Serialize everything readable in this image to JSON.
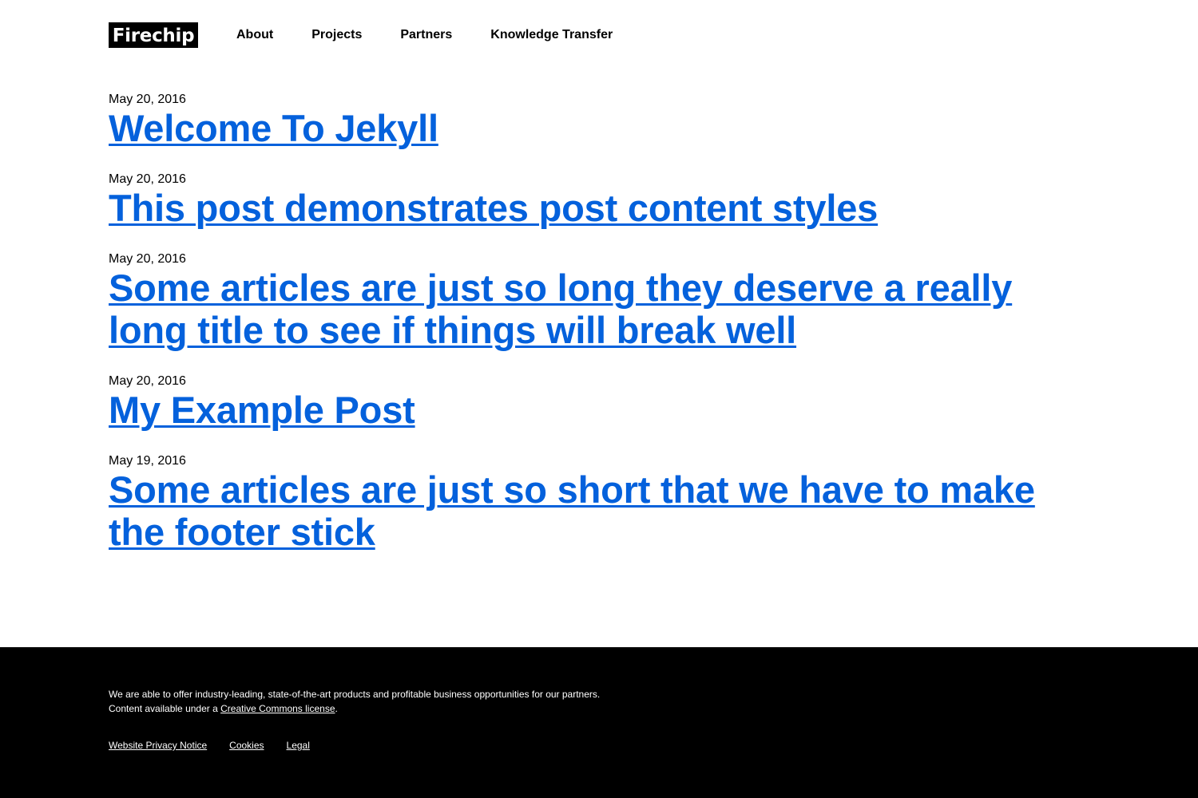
{
  "header": {
    "logo_text": "Firechip",
    "nav": [
      {
        "label": "About"
      },
      {
        "label": "Projects"
      },
      {
        "label": "Partners"
      },
      {
        "label": "Knowledge Transfer"
      }
    ]
  },
  "posts": [
    {
      "date": "May 20, 2016",
      "title": "Welcome To Jekyll"
    },
    {
      "date": "May 20, 2016",
      "title": "This post demonstrates post content styles"
    },
    {
      "date": "May 20, 2016",
      "title": "Some articles are just so long they deserve a really long title to see if things will break well"
    },
    {
      "date": "May 20, 2016",
      "title": "My Example Post"
    },
    {
      "date": "May 19, 2016",
      "title": "Some articles are just so short that we have to make the footer stick"
    }
  ],
  "footer": {
    "tagline": "We are able to offer industry-leading, state-of-the-art products and profitable business opportunities for our partners.",
    "license_prefix": "Content available under a ",
    "license_link": "Creative Commons license",
    "license_suffix": ".",
    "links": [
      {
        "label": "Website Privacy Notice"
      },
      {
        "label": "Cookies"
      },
      {
        "label": "Legal"
      }
    ]
  },
  "colors": {
    "link": "#0461dc",
    "footer_bg": "#000000",
    "logo_bg": "#000000"
  }
}
